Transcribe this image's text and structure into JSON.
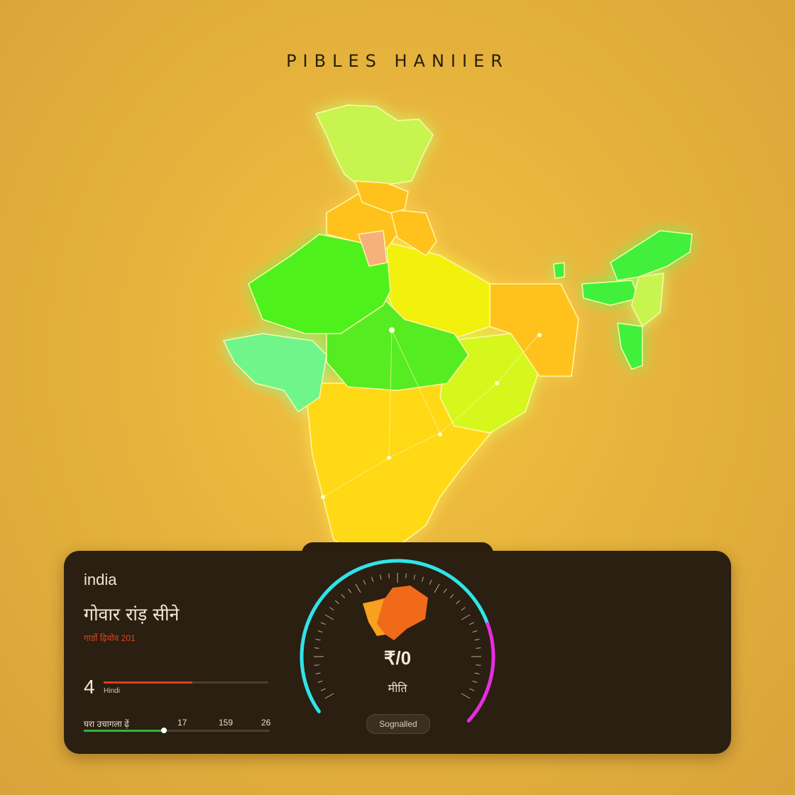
{
  "title": "PIBLES HANIIER",
  "map": {
    "region_colors": {
      "north": "#c8f450",
      "northwest": "#4ff11f",
      "west": "#6ff58a",
      "central": "#55ec20",
      "north_central": "#f2f011",
      "east": "#ffc21a",
      "east_coast": "#d6f71c",
      "peninsula": "#ffd917",
      "northeast": "#3ff03a",
      "accent_pink": "#f6b07a"
    }
  },
  "panel": {
    "country": "india",
    "region_name": "गोवार रांड़ सीने",
    "region_sub": "गार्डो ढ़ियोव 201",
    "metric": {
      "number": "4",
      "label": "Hindi",
      "fill": 0.54
    },
    "scale": {
      "label": "घरा उचागला ढ़ें",
      "ticks": [
        "17",
        "159",
        "26"
      ],
      "knob": 0.43
    }
  },
  "gauge": {
    "value": "₹/0",
    "unit": "मीति",
    "badge": "Sognalled",
    "arc_colors": {
      "primary": "#2fe4e8",
      "secondary": "#e62de0"
    }
  }
}
